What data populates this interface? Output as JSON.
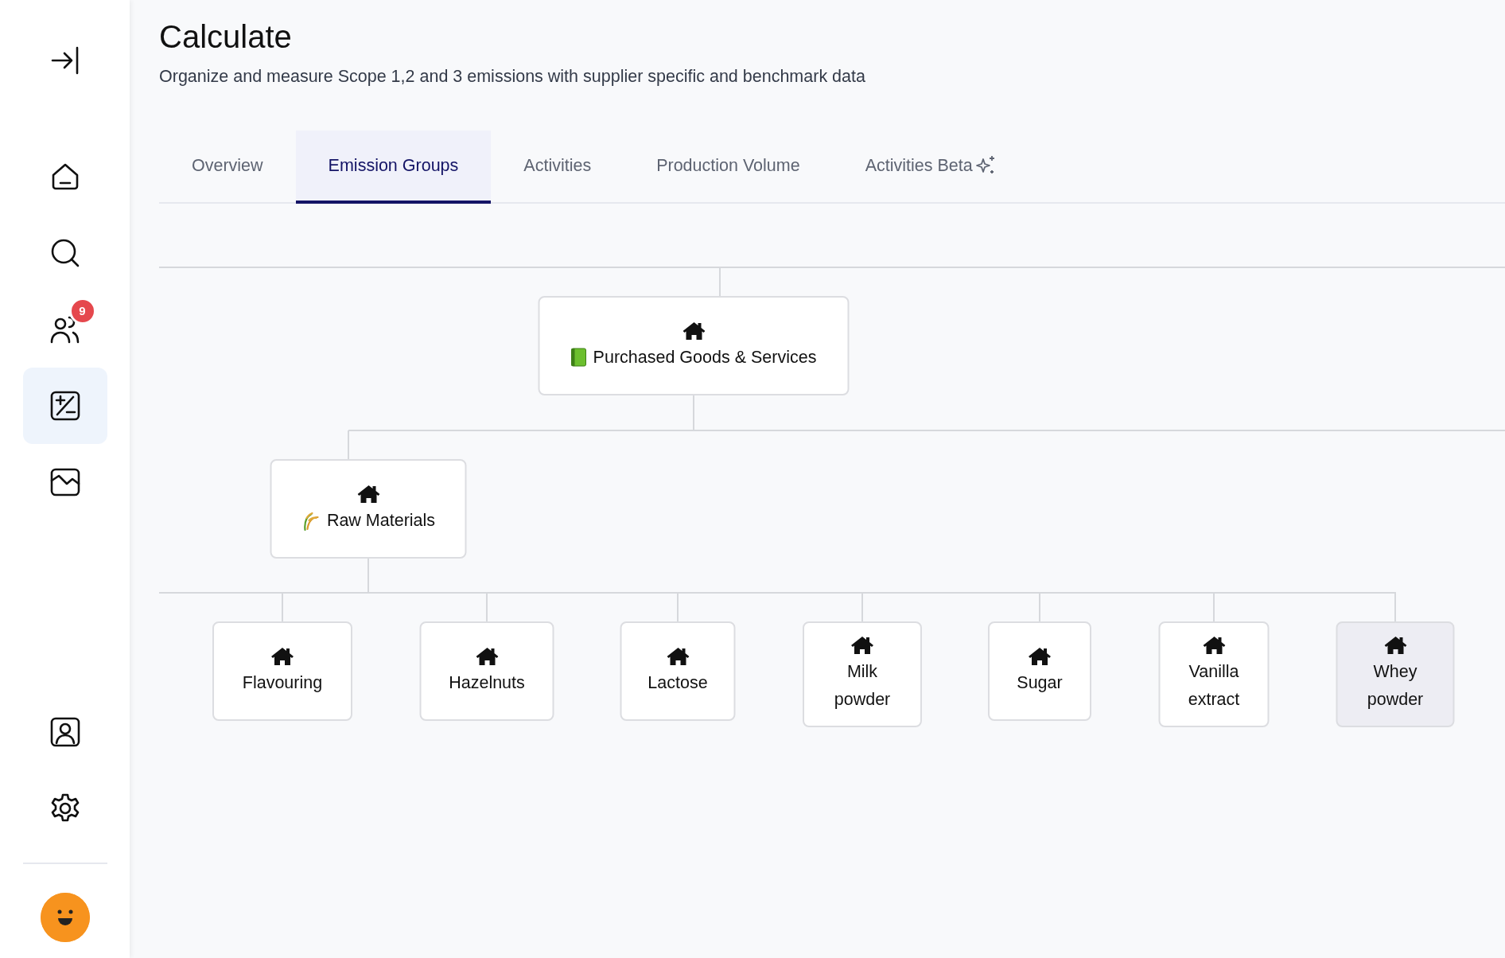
{
  "sidebar": {
    "items": [
      {
        "kind": "collapse",
        "selected": false
      },
      {
        "kind": "home",
        "selected": false
      },
      {
        "kind": "search",
        "selected": false
      },
      {
        "kind": "users",
        "selected": false,
        "badge": "9"
      },
      {
        "kind": "calculator",
        "selected": true
      },
      {
        "kind": "image",
        "selected": false
      }
    ],
    "bottom_items": [
      {
        "kind": "contact",
        "selected": false
      },
      {
        "kind": "settings",
        "selected": false
      }
    ]
  },
  "header": {
    "title": "Calculate",
    "subtitle": "Organize and measure Scope 1,2 and 3 emissions with supplier specific and benchmark data"
  },
  "tabs": [
    {
      "label": "Overview",
      "selected": false
    },
    {
      "label": "Emission Groups",
      "selected": true
    },
    {
      "label": "Activities",
      "selected": false
    },
    {
      "label": "Production Volume",
      "selected": false
    },
    {
      "label": "Activities Beta",
      "selected": false,
      "sparkle": true
    }
  ],
  "tree": {
    "label": "Purchased Goods & Services",
    "highlighted": false,
    "children": [
      {
        "label": "Raw Materials",
        "highlighted": false,
        "children": [
          {
            "label": "Flavouring",
            "highlighted": false
          },
          {
            "label": "Hazelnuts",
            "highlighted": false
          },
          {
            "label": "Lactose",
            "highlighted": false
          },
          {
            "label": "Milk powder",
            "highlighted": false
          },
          {
            "label": "Sugar",
            "highlighted": false
          },
          {
            "label": "Vanilla extract",
            "highlighted": false
          },
          {
            "label": "Whey powder",
            "highlighted": true
          }
        ]
      }
    ]
  }
}
